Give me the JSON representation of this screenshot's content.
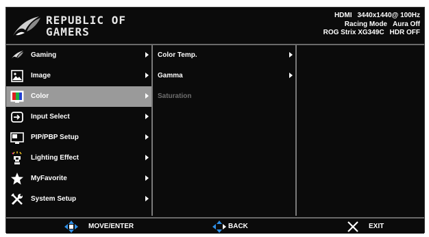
{
  "brand": {
    "line1": "REPUBLIC OF",
    "line2": "GAMERS"
  },
  "status": {
    "row1": [
      "HDMI",
      "3440x1440@ 100Hz"
    ],
    "row2": [
      "Racing Mode",
      "Aura Off"
    ],
    "row3": [
      "ROG Strix XG349C",
      "HDR OFF"
    ]
  },
  "menu": [
    {
      "label": "Gaming",
      "icon": "rog-eye-icon"
    },
    {
      "label": "Image",
      "icon": "image-icon"
    },
    {
      "label": "Color",
      "icon": "color-icon",
      "selected": true
    },
    {
      "label": "Input Select",
      "icon": "input-icon"
    },
    {
      "label": "PIP/PBP Setup",
      "icon": "pip-icon"
    },
    {
      "label": "Lighting Effect",
      "icon": "lighting-icon"
    },
    {
      "label": "MyFavorite",
      "icon": "star-icon"
    },
    {
      "label": "System Setup",
      "icon": "tools-icon"
    }
  ],
  "submenu": [
    {
      "label": "Color Temp.",
      "enabled": true
    },
    {
      "label": "Gamma",
      "enabled": true
    },
    {
      "label": "Saturation",
      "enabled": false
    }
  ],
  "footer": {
    "move_enter": "MOVE/ENTER",
    "back": "BACK",
    "exit": "EXIT"
  },
  "colors": {
    "selected_bg": "#9a9a9a",
    "accent_blue": "#2f8fe6",
    "osd_bg": "#0b0b0b"
  }
}
